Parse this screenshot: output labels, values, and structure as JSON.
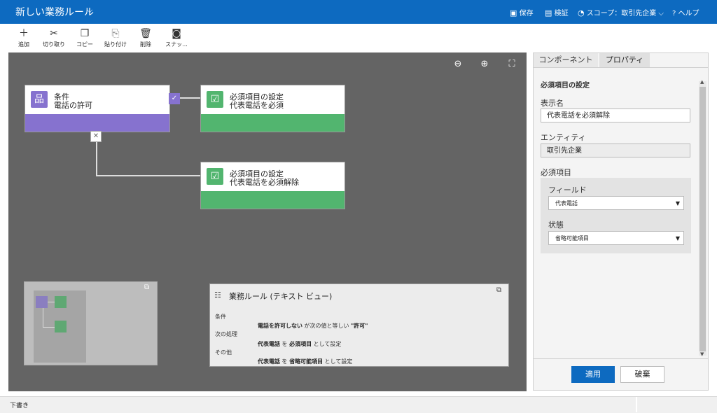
{
  "header": {
    "title": "新しい業務ルール",
    "save": "保存",
    "validate": "検証",
    "scope": "スコープ：取引先企業",
    "help": "ヘルプ"
  },
  "toolbar": {
    "add": "追加",
    "cut": "切り取り",
    "copy": "コピー",
    "paste": "貼り付け",
    "delete": "削除",
    "snapshot": "スナッ..."
  },
  "canvas": {
    "condition": {
      "label": "条件",
      "name": "電話の許可"
    },
    "action_true": {
      "label": "必須項目の設定",
      "name": "代表電話を必須"
    },
    "action_false": {
      "label": "必須項目の設定",
      "name": "代表電話を必須解除"
    }
  },
  "textview": {
    "title": "業務ルール (テキスト ビュー)",
    "lbl_condition": "条件",
    "lbl_then": "次の処理",
    "lbl_else": "その他",
    "row1_a": "電話を許可しない",
    "row1_b": " が次の値と等しい ",
    "row1_c": "\"許可\"",
    "row2_a": "代表電話",
    "row2_b": " を ",
    "row2_c": "必須項目",
    "row2_d": " として設定",
    "row3_a": "代表電話",
    "row3_b": " を ",
    "row3_c": "省略可能項目",
    "row3_d": " として設定"
  },
  "panel": {
    "tab_components": "コンポーネント",
    "tab_properties": "プロパティ",
    "section_title": "必須項目の設定",
    "display_name_label": "表示名",
    "display_name_value": "代表電話を必須解除",
    "entity_label": "エンティティ",
    "entity_value": "取引先企業",
    "required_label": "必須項目",
    "field_label": "フィールド",
    "field_value": "代表電話",
    "state_label": "状態",
    "state_value": "省略可能項目",
    "apply": "適用",
    "discard": "破棄"
  },
  "status": {
    "text": "下書き"
  },
  "colors": {
    "accent": "#0d6ac0",
    "condition": "#8672cf",
    "action": "#52b56f"
  },
  "icons": [
    "chevron-down-icon",
    "save-icon",
    "validate-icon",
    "scope-icon",
    "help-icon",
    "plus-icon",
    "scissors-icon",
    "copy-icon",
    "paste-icon",
    "trash-icon",
    "camera-icon",
    "zoom-out-icon",
    "zoom-in-icon",
    "fit-icon",
    "condition-icon",
    "check-icon",
    "close-icon",
    "expand-icon"
  ]
}
